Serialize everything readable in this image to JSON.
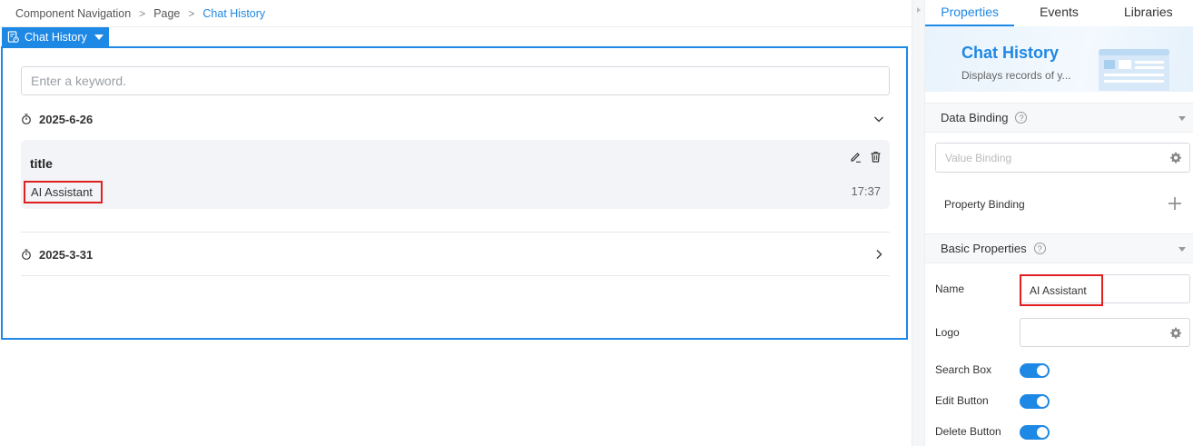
{
  "breadcrumb": {
    "items": [
      "Component Navigation",
      "Page"
    ],
    "current": "Chat History",
    "separator": ">"
  },
  "component": {
    "tag_label": "Chat History",
    "search_placeholder": "Enter a keyword.",
    "groups": [
      {
        "date": "2025-6-26",
        "expanded": true,
        "items": [
          {
            "title": "title",
            "subtitle": "AI Assistant",
            "time": "17:37"
          }
        ]
      },
      {
        "date": "2025-3-31",
        "expanded": false,
        "items": []
      }
    ]
  },
  "panel": {
    "tabs": [
      {
        "label": "Properties",
        "active": true
      },
      {
        "label": "Events",
        "active": false
      },
      {
        "label": "Libraries",
        "active": false
      }
    ],
    "hero": {
      "title": "Chat History",
      "description": "Displays records of y..."
    },
    "data_binding": {
      "heading": "Data Binding",
      "value_binding_placeholder": "Value Binding",
      "property_binding_label": "Property Binding"
    },
    "basic_properties": {
      "heading": "Basic Properties",
      "name_label": "Name",
      "name_value": "AI Assistant",
      "logo_label": "Logo",
      "toggles": [
        {
          "label": "Search Box",
          "on": true
        },
        {
          "label": "Edit Button",
          "on": true
        },
        {
          "label": "Delete Button",
          "on": true
        }
      ]
    }
  },
  "colors": {
    "accent": "#1e88e5",
    "highlight": "#e02020"
  }
}
